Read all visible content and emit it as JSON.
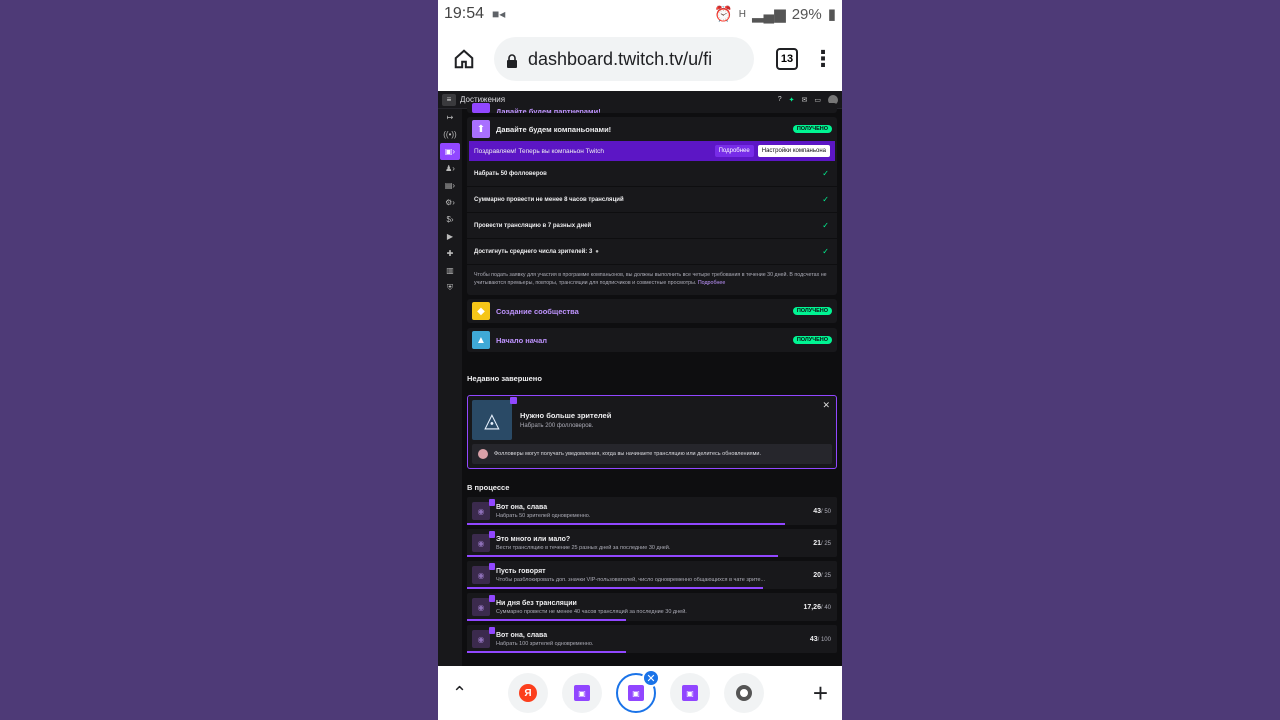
{
  "statusbar": {
    "time": "19:54",
    "battery": "29%",
    "net": "H"
  },
  "browser": {
    "url": "dashboard.twitch.tv/u/fi",
    "tab_count": "13"
  },
  "twitch": {
    "header_title": "Достижения",
    "partial_top_title": "Давайте будем партнерами!",
    "companion": {
      "title": "Давайте будем компаньонами!",
      "badge": "ПОЛУЧЕНО",
      "congrats_text": "Поздравляем! Теперь вы компаньон Twitch",
      "more_btn": "Подробнее",
      "settings_btn": "Настройки компаньона",
      "requirements": [
        "Набрать 50 фолловеров",
        "Суммарно провести не менее 8 часов трансляций",
        "Провести трансляцию в 7 разных дней",
        "Достигнуть среднего числа зрителей: 3"
      ],
      "note": "Чтобы подать заявку для участия в программе компаньонов, вы должны выполнить все четыре требования в течение 30 дней. В подсчетах не учитываются премьеры, повторы, трансляции для подписчиков и совместные просмотры.",
      "note_link": "Подробнее"
    },
    "community": {
      "title": "Создание сообщества",
      "badge": "ПОЛУЧЕНО"
    },
    "start": {
      "title": "Начало начал",
      "badge": "ПОЛУЧЕНО"
    },
    "recent_title": "Недавно завершено",
    "recent": {
      "title": "Нужно больше зрителей",
      "desc": "Набрать 200 фолловеров.",
      "info": "Фолловеры могут получать уведомления, когда вы начинаете трансляцию или делитесь обновлениями."
    },
    "progress_title": "В процессе",
    "progress": [
      {
        "title": "Вот она, слава",
        "desc": "Набрать 50 зрителей одновременно.",
        "current": "43",
        "total": "/ 50",
        "fraction": 0.86
      },
      {
        "title": "Это много или мало?",
        "desc": "Вести трансляцию в течение 25 разных дней за последние 30 дней.",
        "current": "21",
        "total": "/ 25",
        "fraction": 0.84
      },
      {
        "title": "Пусть говорят",
        "desc": "Чтобы разблокировать доп. значки VIP-пользователей, число одновременно общающихся в чате зрите...",
        "current": "20",
        "total": "/ 25",
        "fraction": 0.8
      },
      {
        "title": "Ни дня без трансляции",
        "desc": "Суммарно провести не менее 40 часов трансляций за последние 30 дней.",
        "current": "17,26",
        "total": "/ 40",
        "fraction": 0.43
      },
      {
        "title": "Вот она, слава",
        "desc": "Набрать 100 зрителей одновременно.",
        "current": "43",
        "total": "/ 100",
        "fraction": 0.43
      }
    ]
  },
  "tabstrip": {
    "ya_label": "Я"
  },
  "colors": {
    "twitch_purple": "#9147ff",
    "success_green": "#00f593",
    "background": "#0e0e10"
  }
}
